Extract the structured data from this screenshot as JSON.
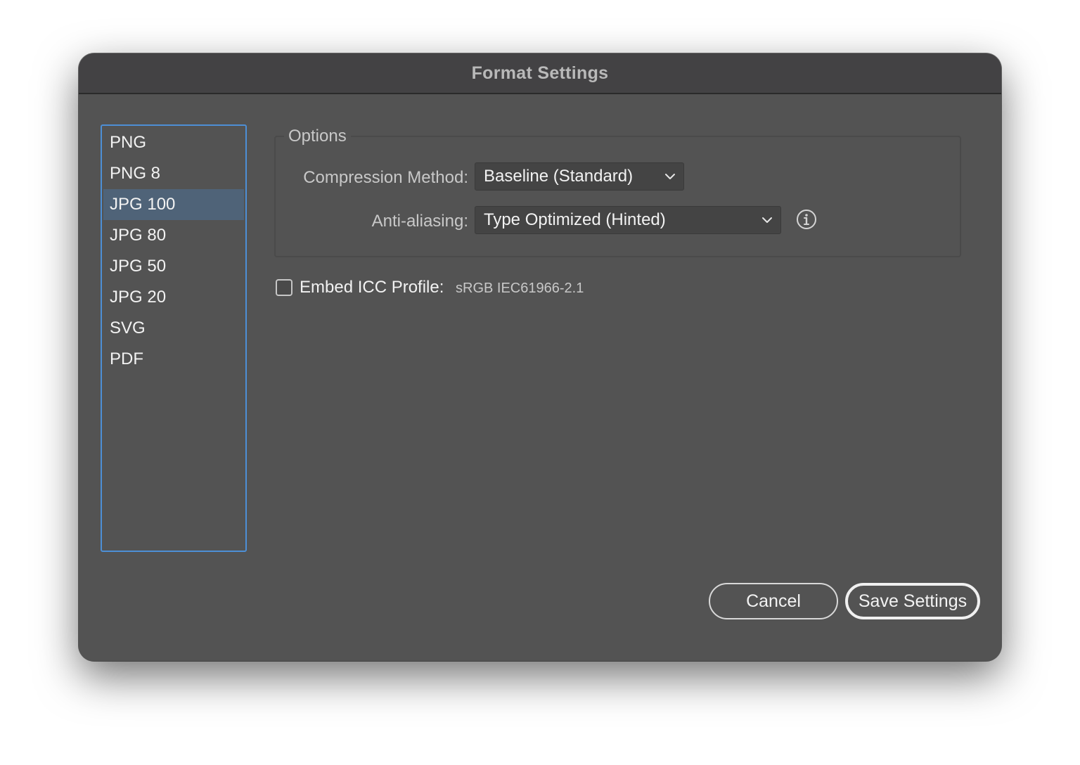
{
  "dialog": {
    "title": "Format Settings"
  },
  "formats": {
    "items": [
      "PNG",
      "PNG 8",
      "JPG 100",
      "JPG 80",
      "JPG 50",
      "JPG 20",
      "SVG",
      "PDF"
    ],
    "selected": "JPG 100"
  },
  "options": {
    "legend": "Options",
    "compression_label": "Compression Method:",
    "compression_value": "Baseline (Standard)",
    "antialias_label": "Anti-aliasing:",
    "antialias_value": "Type Optimized (Hinted)"
  },
  "icc": {
    "label": "Embed ICC Profile:",
    "profile": "sRGB IEC61966-2.1",
    "checked": false
  },
  "buttons": {
    "cancel": "Cancel",
    "save": "Save Settings"
  },
  "icons": {
    "dropdown": "chevron-down-icon",
    "info": "info-icon"
  },
  "colors": {
    "accent": "#4d8fd6",
    "selection": "#4f6378",
    "panel": "#535353",
    "titlebar": "#434244"
  }
}
